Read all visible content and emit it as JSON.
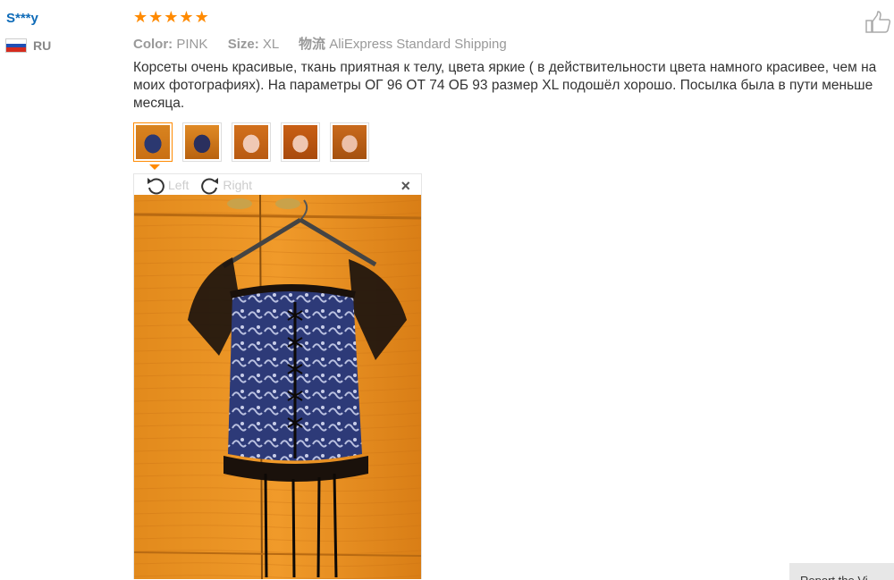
{
  "reviewer": {
    "name": "S***y",
    "country_code": "RU"
  },
  "rating": {
    "stars": 5,
    "max": 5,
    "star_color": "#ff8a00"
  },
  "meta": {
    "color_label": "Color:",
    "color_value": "PINK",
    "size_label": "Size:",
    "size_value": "XL",
    "shipping_label": "物流",
    "shipping_value": "AliExpress Standard Shipping"
  },
  "review_text": "Корсеты очень красивые, ткань приятная к телу, цвета яркие ( в действительности цвета намного красивее, чем на моих фотографиях). На параметры ОГ 96 ОТ 74 ОБ 93 размер XL подошёл хорошо. Посылка была в пути меньше месяца.",
  "thumbnails": [
    {
      "name": "photo-1",
      "active": true
    },
    {
      "name": "photo-2",
      "active": false
    },
    {
      "name": "photo-3",
      "active": false
    },
    {
      "name": "photo-4",
      "active": false
    },
    {
      "name": "photo-5",
      "active": false
    }
  ],
  "viewer": {
    "rotate_left": "Left",
    "rotate_right": "Right",
    "close_symbol": "×"
  },
  "bottom_button": "Report the Vi...",
  "icons": [
    "thumbs-up-icon",
    "rotate-left-icon",
    "rotate-right-icon",
    "close-icon",
    "star-icon",
    "flag-icon"
  ],
  "colors": {
    "link_blue": "#0e6bb8",
    "accent_orange": "#ff8a00",
    "muted_gray": "#999999"
  }
}
